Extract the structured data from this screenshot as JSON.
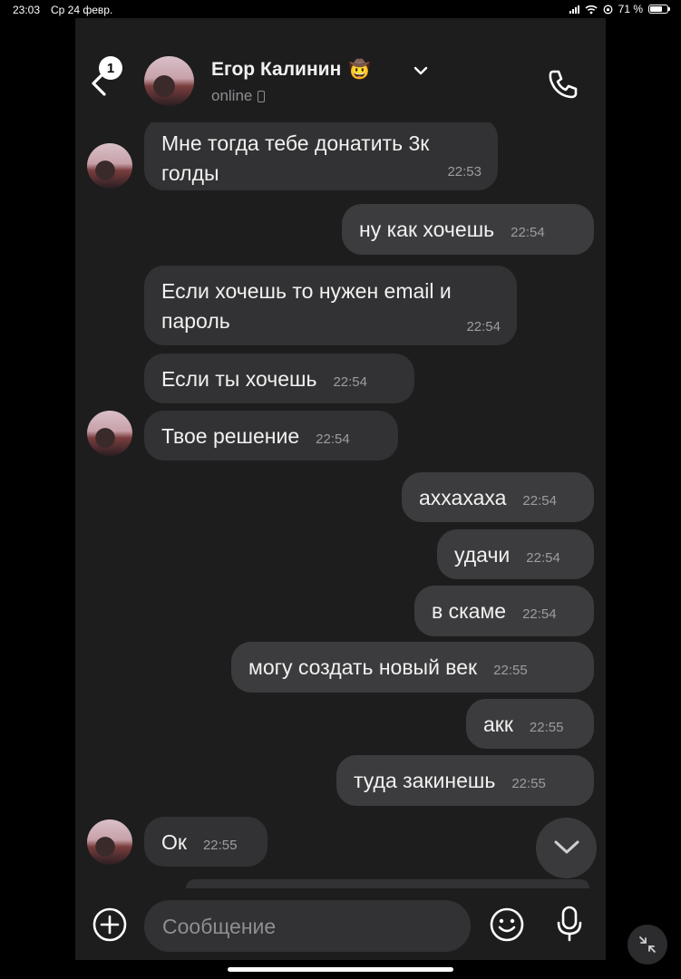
{
  "status_bar": {
    "time": "23:03",
    "date": "Ср 24 февр.",
    "battery_percent": "71 %",
    "battery_level": 0.71
  },
  "header": {
    "unread_count": "1",
    "contact_name": "Егор Калинин",
    "name_emoji": "🤠",
    "presence": "online",
    "icons": [
      "back-chevron-icon",
      "chevron-down-icon",
      "mobile-device-icon",
      "phone-icon"
    ]
  },
  "messages": [
    {
      "dir": "in",
      "text": "Мне тогда тебе донатить 3к голды",
      "time": "22:53"
    },
    {
      "dir": "out",
      "text": "ну как хочешь",
      "time": "22:54"
    },
    {
      "dir": "in",
      "text": "Если хочешь то нужен email и пароль",
      "time": "22:54"
    },
    {
      "dir": "in",
      "text": "Если ты хочешь",
      "time": "22:54"
    },
    {
      "dir": "in",
      "text": "Твое решение",
      "time": "22:54"
    },
    {
      "dir": "out",
      "text": "аххахаха",
      "time": "22:54"
    },
    {
      "dir": "out",
      "text": "удачи",
      "time": "22:54"
    },
    {
      "dir": "out",
      "text": "в скаме",
      "time": "22:54"
    },
    {
      "dir": "out",
      "text": "могу создать новый век",
      "time": "22:55"
    },
    {
      "dir": "out",
      "text": "акк",
      "time": "22:55"
    },
    {
      "dir": "out",
      "text": "туда закинешь",
      "time": "22:55"
    },
    {
      "dir": "in",
      "text": "Ок",
      "time": "22:55"
    }
  ],
  "composer": {
    "placeholder": "Сообщение",
    "icons": [
      "plus-circle-icon",
      "smile-icon",
      "microphone-icon"
    ]
  }
}
